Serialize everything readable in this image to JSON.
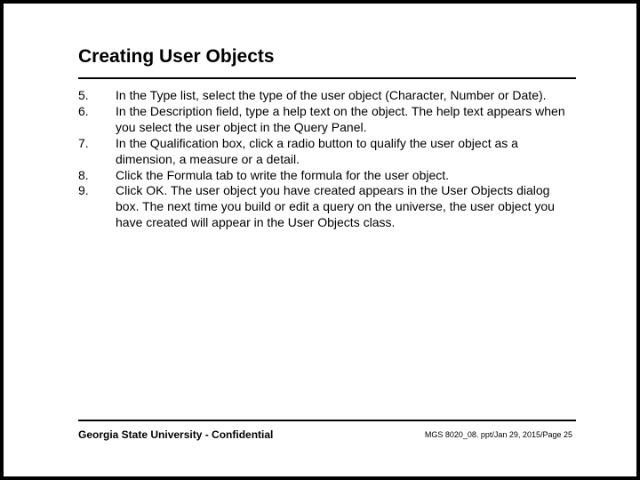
{
  "title": "Creating User Objects",
  "items": [
    {
      "n": "5.",
      "t": "In the Type list, select the type of the user object (Character, Number or Date)."
    },
    {
      "n": "6.",
      "t": "In the Description field, type a help text on the object.  The help text appears when you select the user object in the Query Panel."
    },
    {
      "n": "7.",
      "t": "In the Qualification box, click a radio button to qualify the user object as a dimension, a measure or a detail."
    },
    {
      "n": "8.",
      "t": "Click the Formula tab to write the formula for the user object."
    },
    {
      "n": "9.",
      "t": "Click OK.  The user object you have created appears in the User Objects dialog box. The next time you build or edit a query on the universe, the user object you have created will appear in the User Objects class."
    }
  ],
  "footer_left": "Georgia State University - Confidential",
  "footer_right": "MGS 8020_08. ppt/Jan 29, 2015/Page 25"
}
